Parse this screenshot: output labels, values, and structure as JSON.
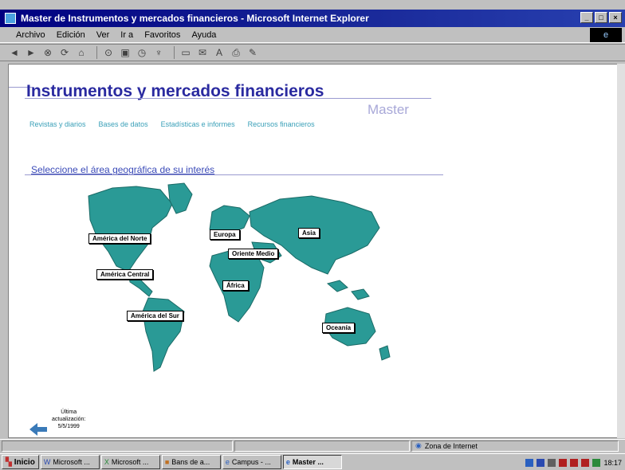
{
  "window": {
    "title": "Master de Instrumentos y mercados financieros - Microsoft Internet Explorer"
  },
  "menu": [
    "Archivo",
    "Edición",
    "Ver",
    "Ir a",
    "Favoritos",
    "Ayuda"
  ],
  "page": {
    "title": "Instrumentos y mercados financieros",
    "subtitle": "Master",
    "nav": [
      "Revistas y diarios",
      "Bases de datos",
      "Estadísticas e informes",
      "Recursos financieros"
    ],
    "select_prompt": "Seleccione el área geográfica de su interés",
    "regions": {
      "north_america": "América del Norte",
      "central_america": "América Central",
      "south_america": "América del Sur",
      "europe": "Europa",
      "asia": "Asia",
      "middle_east": "Oriente Medio",
      "africa": "África",
      "oceania": "Oceanía"
    },
    "update_line1": "Última",
    "update_line2": "actualización:",
    "update_date": "5/5/1999"
  },
  "status": {
    "zone": "Zona de Internet"
  },
  "taskbar": {
    "start": "Inicio",
    "tasks": [
      "Microsoft ...",
      "Microsoft ...",
      "Bans de a...",
      "Campus - ...",
      "Master ..."
    ],
    "time": "18:17"
  },
  "colors": {
    "title_blue": "#2a2aa0",
    "nav_teal": "#3aa0b8",
    "map_teal": "#2a9a96"
  }
}
